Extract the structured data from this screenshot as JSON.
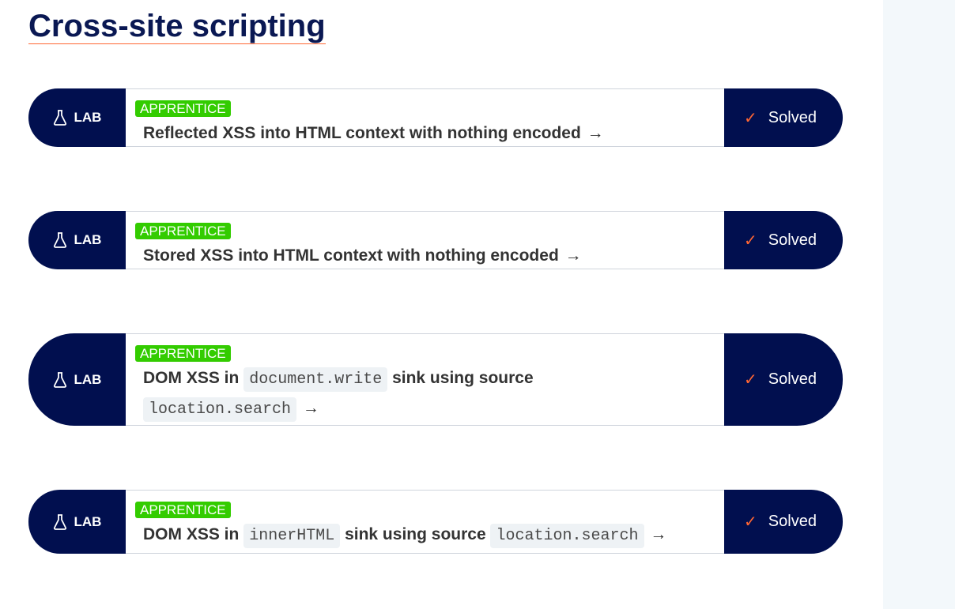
{
  "page": {
    "title": "Cross-site scripting"
  },
  "labs": [
    {
      "tag": "LAB",
      "level": "APPRENTICE",
      "title_parts": [
        "Reflected XSS into HTML context with nothing encoded"
      ],
      "status": "Solved"
    },
    {
      "tag": "LAB",
      "level": "APPRENTICE",
      "title_parts": [
        "Stored XSS into HTML context with nothing encoded"
      ],
      "status": "Solved"
    },
    {
      "tag": "LAB",
      "level": "APPRENTICE",
      "title_parts": [
        "DOM XSS in",
        "document.write",
        "sink using source",
        "location.search"
      ],
      "status": "Solved"
    },
    {
      "tag": "LAB",
      "level": "APPRENTICE",
      "title_parts": [
        "DOM XSS in",
        "innerHTML",
        "sink using source",
        "location.search"
      ],
      "status": "Solved"
    }
  ],
  "arrow_glyph": "→",
  "check_glyph": "✓",
  "colors": {
    "navy": "#010f4f",
    "badge_green": "#33cc00",
    "accent_orange": "#ff6633"
  },
  "icons": {
    "lab": "flask-icon",
    "solved": "checkmark-icon"
  }
}
